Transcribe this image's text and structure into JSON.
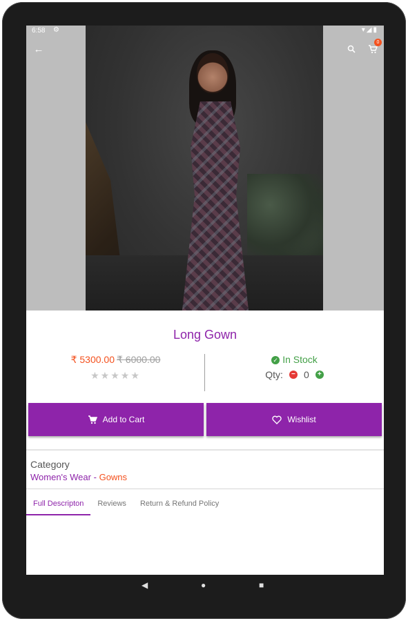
{
  "status_bar": {
    "time": "6:58",
    "icons": [
      "settings-icon",
      "wifi-icon",
      "signal-icon",
      "battery-icon"
    ]
  },
  "app_bar": {
    "back_icon": "arrow-left-icon",
    "search_icon": "search-icon",
    "cart_icon": "cart-icon",
    "cart_count": "0"
  },
  "product": {
    "title": "Long Gown",
    "sale_price": "₹ 5300.00",
    "original_price": "₹ 6000.00",
    "rating": 0,
    "stars": "★★★★★",
    "stock_status": "In Stock",
    "qty_label": "Qty:",
    "qty_value": "0"
  },
  "actions": {
    "add_to_cart": "Add to Cart",
    "wishlist": "Wishlist"
  },
  "category": {
    "label": "Category",
    "main": "Women's Wear",
    "separator": "-",
    "sub": "Gowns"
  },
  "tabs": [
    {
      "label": "Full Descripton",
      "active": true
    },
    {
      "label": "Reviews",
      "active": false
    },
    {
      "label": "Return & Refund Policy",
      "active": false
    }
  ],
  "colors": {
    "accent": "#8e24aa",
    "sale": "#f4511e",
    "in_stock": "#43a047",
    "minus": "#e53935"
  }
}
